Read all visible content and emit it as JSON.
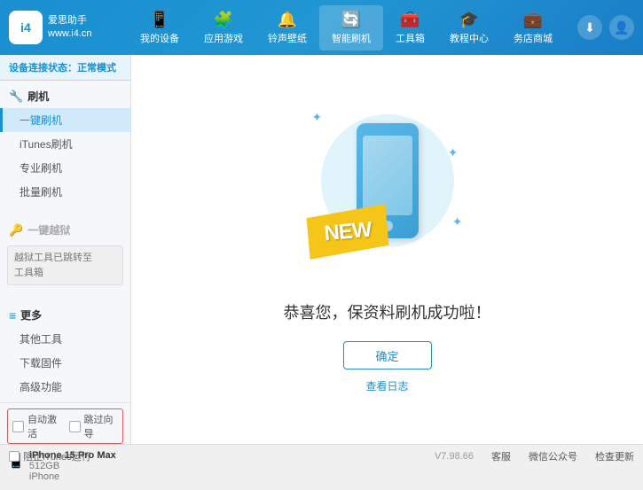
{
  "header": {
    "logo_text_line1": "爱思助手",
    "logo_text_line2": "www.i4.cn",
    "logo_initials": "i4",
    "nav": [
      {
        "id": "my-device",
        "icon": "📱",
        "label": "我的设备"
      },
      {
        "id": "app-games",
        "icon": "👤",
        "label": "应用游戏"
      },
      {
        "id": "ringtone",
        "icon": "🔔",
        "label": "铃声壁纸"
      },
      {
        "id": "smart-flash",
        "icon": "🔄",
        "label": "智能刷机",
        "active": true
      },
      {
        "id": "toolbox",
        "icon": "🧰",
        "label": "工具箱"
      },
      {
        "id": "tutorial",
        "icon": "🎓",
        "label": "教程中心"
      },
      {
        "id": "service",
        "icon": "💼",
        "label": "务店商城"
      }
    ],
    "download_icon": "⬇",
    "user_icon": "👤"
  },
  "sidebar": {
    "status_label": "设备连接状态：",
    "status_value": "正常模式",
    "sections": [
      {
        "id": "flash",
        "icon": "🔧",
        "label": "刷机",
        "items": [
          {
            "id": "one-key-flash",
            "label": "一键刷机",
            "active": true
          },
          {
            "id": "itunes-flash",
            "label": "iTunes刷机"
          },
          {
            "id": "pro-flash",
            "label": "专业刷机"
          },
          {
            "id": "batch-flash",
            "label": "批量刷机"
          }
        ]
      }
    ],
    "disabled_section": {
      "icon": "🔑",
      "label": "一键越狱",
      "disabled": true
    },
    "note_text": "越狱工具已跳转至\n工具箱",
    "more_section": {
      "icon": "≡",
      "label": "更多",
      "items": [
        {
          "id": "other-tools",
          "label": "其他工具"
        },
        {
          "id": "download-firmware",
          "label": "下载固件"
        },
        {
          "id": "advanced",
          "label": "高级功能"
        }
      ]
    },
    "auto_activate_label": "自动激活",
    "guide_label": "跳过向导",
    "device": {
      "name": "iPhone 15 Pro Max",
      "storage": "512GB",
      "type": "iPhone"
    }
  },
  "content": {
    "new_label": "NEW",
    "success_title": "恭喜您，保资料刷机成功啦！",
    "confirm_button": "确定",
    "log_link": "查看日志"
  },
  "footer": {
    "stop_itunes_label": "阻止iTunes运行",
    "version": "V7.98.66",
    "links": [
      "客服",
      "微信公众号",
      "检查更新"
    ]
  }
}
